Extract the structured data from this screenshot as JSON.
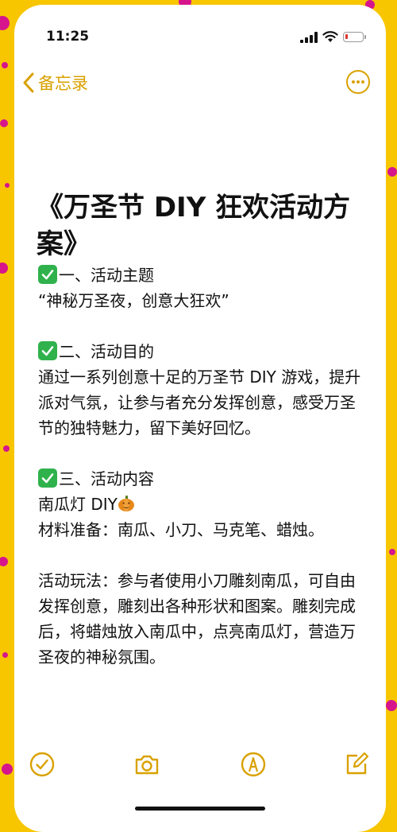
{
  "status_bar": {
    "time": "11:25",
    "battery_level_fraction": 0.15
  },
  "nav": {
    "back_label": "备忘录",
    "back_icon": "chevron-left-icon",
    "more_icon": "ellipsis-circle-icon",
    "accent_color": "#d9a100"
  },
  "note": {
    "title": "《万圣节 DIY 狂欢活动方案》",
    "sections": [
      {
        "heading": "一、活动主题",
        "lines": [
          "“神秘万圣夜，创意大狂欢”"
        ]
      },
      {
        "heading": "二、活动目的",
        "lines": [
          "通过一系列创意十足的万圣节 DIY 游戏，提升派对气氛，让参与者充分发挥创意，感受万圣节的独特魅力，留下美好回忆。"
        ]
      },
      {
        "heading": "三、活动内容",
        "lines": [
          "南瓜灯 DIY",
          "材料准备：南瓜、小刀、马克笔、蜡烛。"
        ]
      }
    ],
    "play_text": "活动玩法：参与者使用小刀雕刻南瓜，可自由发挥创意，雕刻出各种形状和图案。雕刻完成后，将蜡烛放入南瓜中，点亮南瓜灯，营造万圣夜的神秘氛围。"
  },
  "toolbar": {
    "items": [
      "checklist-icon",
      "camera-icon",
      "markup-pen-icon",
      "compose-icon"
    ]
  },
  "colors": {
    "background": "#f7c600",
    "dots": "#d6158c",
    "check": "#2fb24c"
  }
}
